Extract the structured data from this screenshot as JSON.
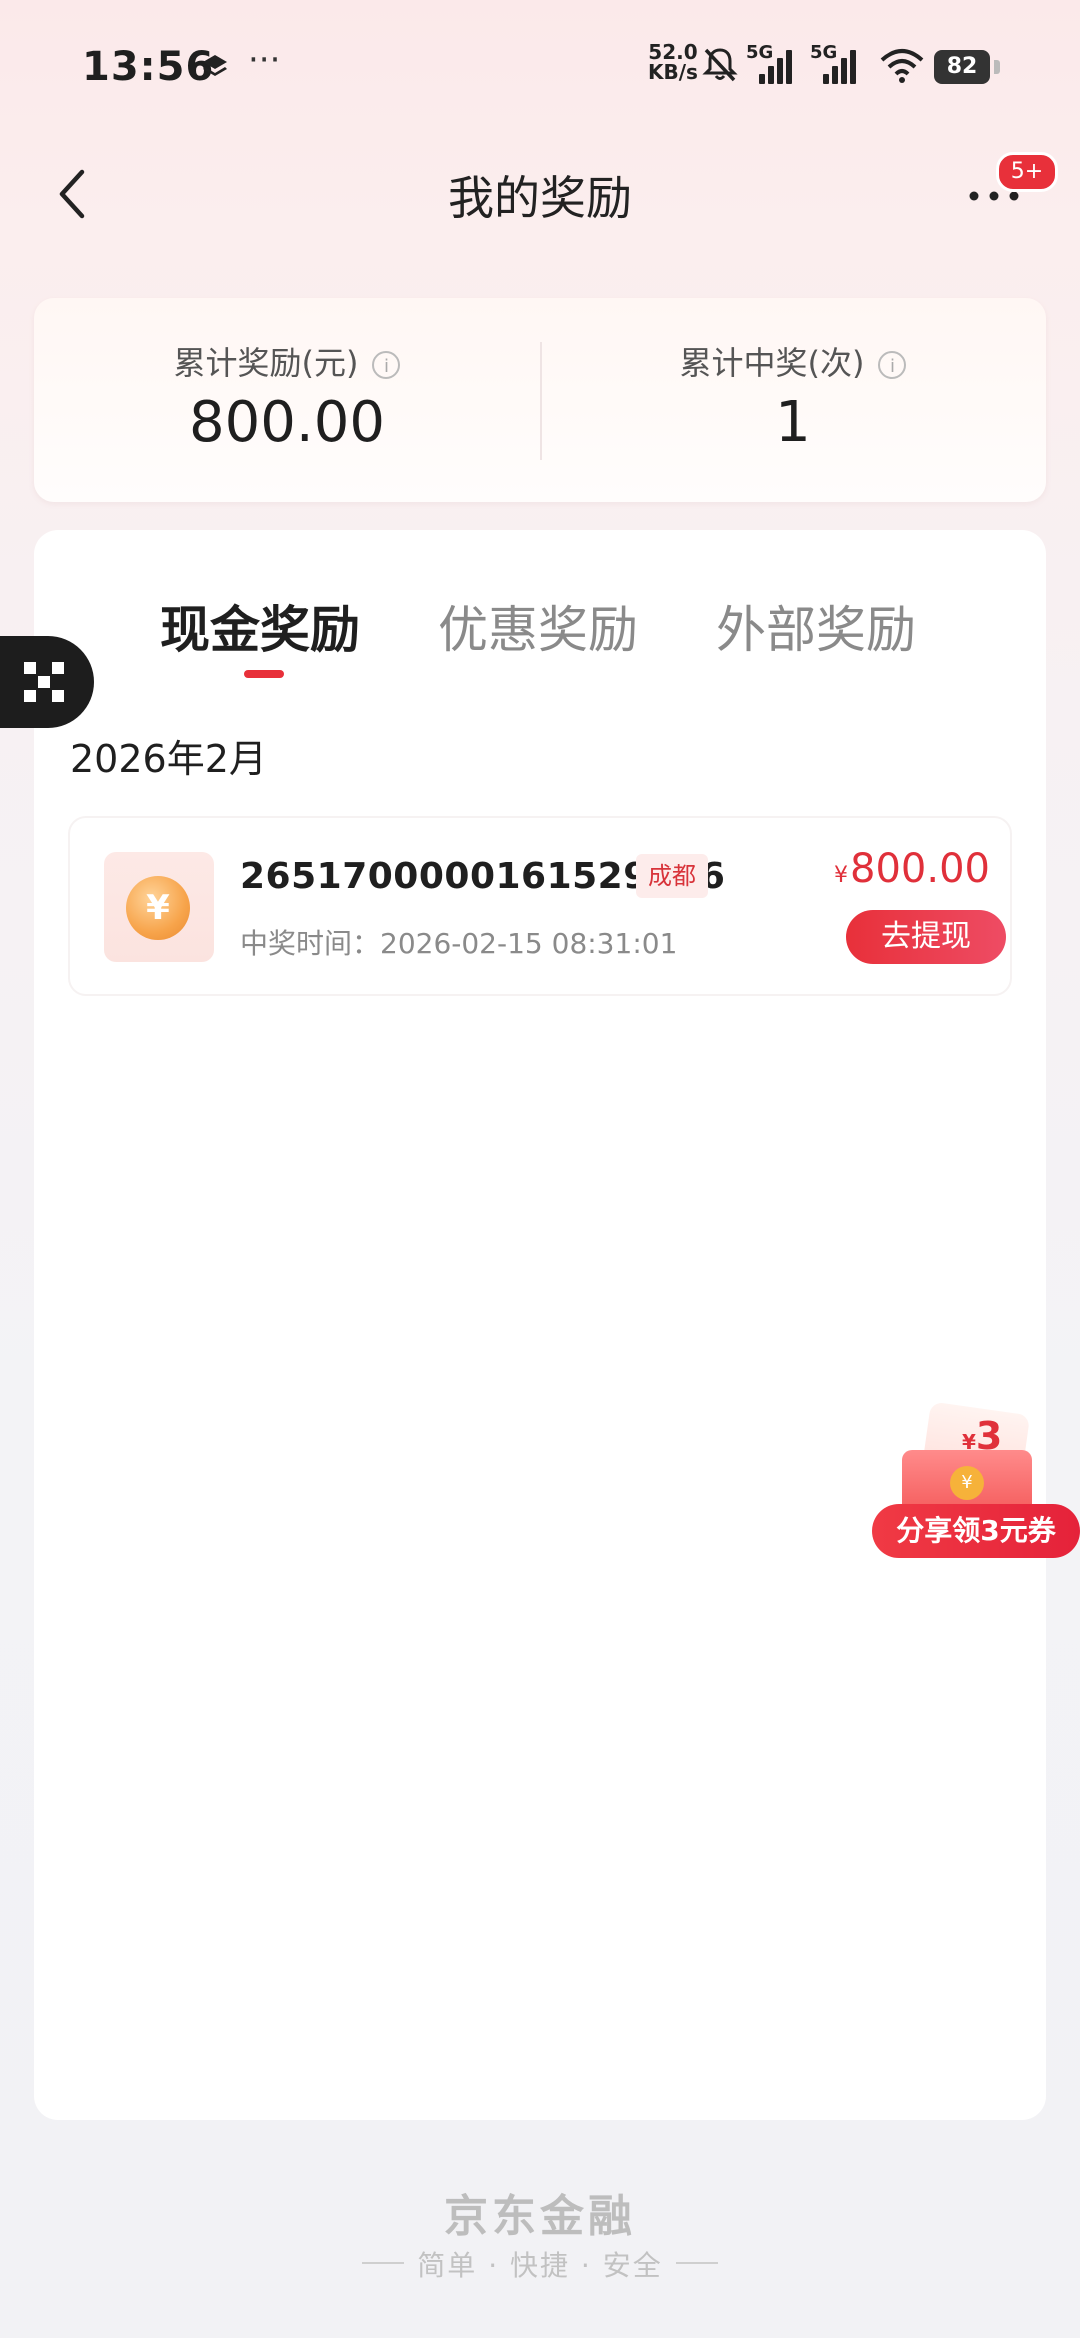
{
  "status_bar": {
    "time": "13:56",
    "net_speed_value": "52.0",
    "net_speed_unit": "KB/s",
    "signal1_label": "5G",
    "signal2_label": "5G",
    "battery": "82"
  },
  "nav": {
    "title": "我的奖励",
    "badge": "5+"
  },
  "summary": {
    "total_reward_label": "累计奖励(元)",
    "total_reward_value": "800.00",
    "total_wins_label": "累计中奖(次)",
    "total_wins_value": "1"
  },
  "tabs": [
    {
      "label": "现金奖励",
      "active": true
    },
    {
      "label": "优惠奖励",
      "active": false
    },
    {
      "label": "外部奖励",
      "active": false
    }
  ],
  "month_header": "2026年2月",
  "reward_item": {
    "id": "2651700000161529666",
    "city": "成都",
    "win_time": "中奖时间：2026-02-15 08:31:01",
    "currency": "¥",
    "amount": "800.00",
    "action": "去提现"
  },
  "share_float": {
    "amount": "3",
    "currency": "¥",
    "label": "分享领3元券"
  },
  "footer": {
    "brand": "京东金融",
    "slogan": "简单 · 快捷 · 安全"
  },
  "colors": {
    "accent": "#e8303a",
    "tab_active": "#1f1f1f",
    "tab_inactive": "#8a8a8a"
  }
}
